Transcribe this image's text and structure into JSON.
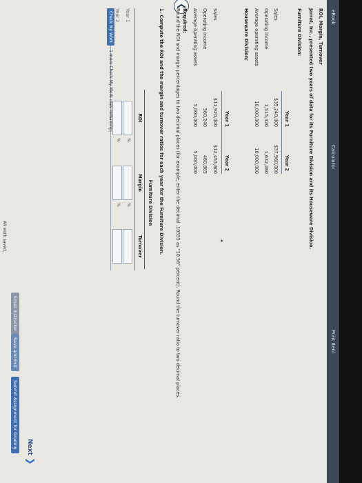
{
  "topbar": {
    "ebook": "eBook",
    "calculator": "Calculator",
    "print_item": "Print Item"
  },
  "problem": {
    "title": "ROI, Margin, Turnover",
    "intro": "Jarrot, Inc., presented two years of data for its Furniture Division and its Houseware Division."
  },
  "furniture": {
    "heading": "Furniture Division:",
    "col_year1": "Year 1",
    "col_year2": "Year 2",
    "rows": [
      {
        "label": "Sales",
        "y1": "$35,240,000",
        "y2": "$37,960,000"
      },
      {
        "label": "Operating income",
        "y1": "1,515,320",
        "y2": "1,632,280"
      },
      {
        "label": "Average operating assets",
        "y1": "10,000,000",
        "y2": "10,000,000"
      }
    ]
  },
  "houseware": {
    "heading": "Houseware Division:",
    "col_year1": "Year 1",
    "col_year2": "Year 2",
    "rows": [
      {
        "label": "Sales",
        "y1": "$11,920,000",
        "y2": "$12,455,800"
      },
      {
        "label": "Operating income",
        "y1": "560,240",
        "y2": "460,865"
      },
      {
        "label": "Average operating assets",
        "y1": "5,000,000",
        "y2": "5,000,000"
      }
    ]
  },
  "required": {
    "heading": "Required:",
    "instruction": "Round the ROI and margin percentages to two decimal places (for example, enter the decimal .10555 as \"10.56\" percent). Round the turnover ratio to two decimal places.",
    "question": "1. Compute the ROI and the margin and turnover ratios for each year for the Furniture Division."
  },
  "answer_table": {
    "title": "Furniture Division",
    "col_roi": "ROI",
    "col_margin": "Margin",
    "col_turnover": "Turnover",
    "row1": "Year 1",
    "row2": "Year 2",
    "pct": "%"
  },
  "footer": {
    "check_button": "Check My Work",
    "check_note": "1 more Check My Work uses remaining.",
    "saved": "All work saved.",
    "email": "Email Instructor",
    "save_exit": "Save and Exit",
    "submit": "Submit Assignment for Grading",
    "next": "Next"
  },
  "colors": {
    "topbar": "#3d4856",
    "email_btn": "#8a96a6",
    "save_btn": "#6a8bb5",
    "submit_btn": "#3f6fb0",
    "next": "#2b6fcc"
  }
}
